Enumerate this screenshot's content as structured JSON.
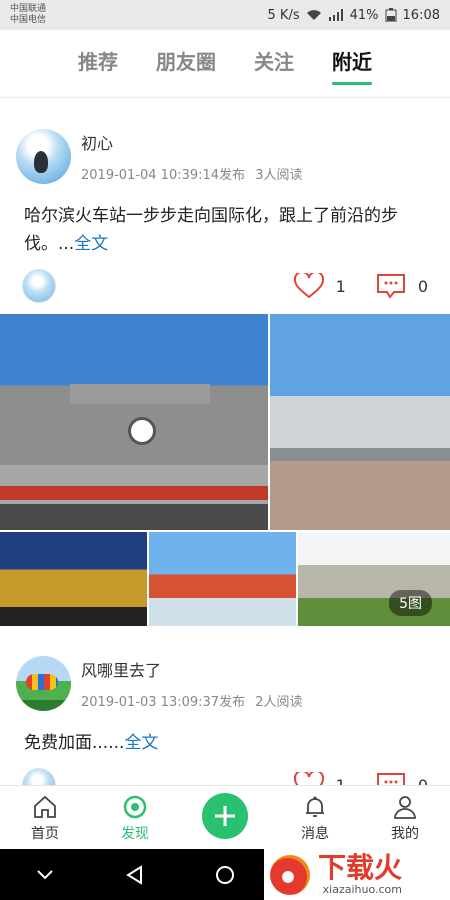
{
  "status_bar": {
    "carrier1": "中国联通",
    "carrier2": "中国电信",
    "speed": "5 K/s",
    "battery": "41%",
    "time": "16:08"
  },
  "tabs": [
    {
      "label": "推荐"
    },
    {
      "label": "朋友圈"
    },
    {
      "label": "关注"
    },
    {
      "label": "附近"
    }
  ],
  "posts": [
    {
      "username": "初心",
      "time": "2019-01-04 10:39:14发布",
      "reads": "3人阅读",
      "text": "哈尔滨火车站一步步走向国际化，跟上了前沿的步伐。...",
      "more": "全文",
      "likes": "1",
      "comments": "0",
      "image_count": "5图"
    },
    {
      "username": "风哪里去了",
      "time": "2019-01-03 13:09:37发布",
      "reads": "2人阅读",
      "text": "免费加面......",
      "more": "全文",
      "likes": "1",
      "comments": "0"
    }
  ],
  "bottom_nav": [
    {
      "label": "首页",
      "icon": "home-icon"
    },
    {
      "label": "发现",
      "icon": "discover-icon"
    },
    {
      "label": "",
      "icon": "add-icon"
    },
    {
      "label": "消息",
      "icon": "bell-icon"
    },
    {
      "label": "我的",
      "icon": "user-icon"
    }
  ],
  "watermark": {
    "cn": "下载火",
    "url": "xiazaihuo.com"
  },
  "colors": {
    "accent": "#27c16f",
    "link": "#1a76c9"
  }
}
